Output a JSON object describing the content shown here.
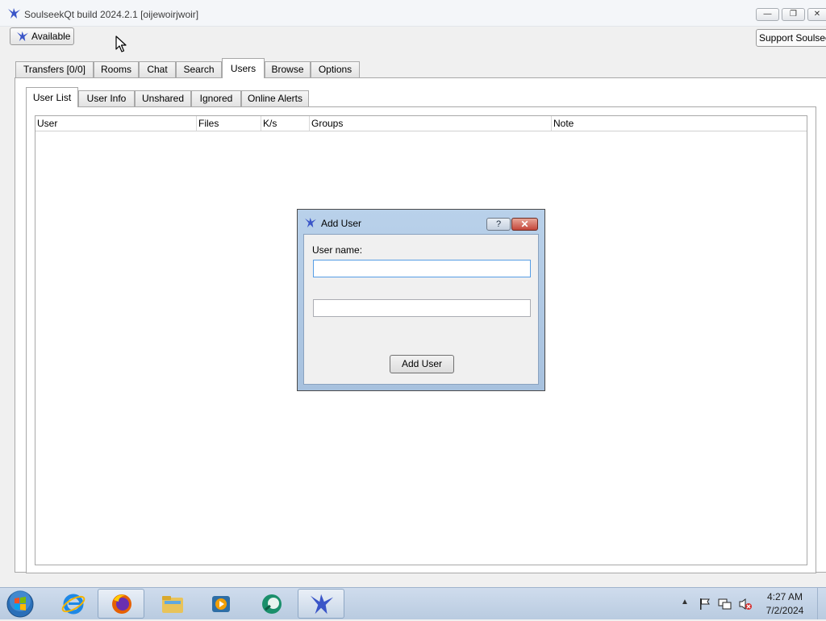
{
  "window": {
    "title": "SoulseekQt build 2024.2.1 [oijewoirjwoir]",
    "controls": {
      "minimize": "—",
      "maximize": "❐",
      "close": "✕"
    }
  },
  "toolbar": {
    "status_label": "Available",
    "support_label": "Support Soulseek"
  },
  "main_tabs": [
    {
      "label": "Transfers [0/0]",
      "active": false
    },
    {
      "label": "Rooms",
      "active": false
    },
    {
      "label": "Chat",
      "active": false
    },
    {
      "label": "Search",
      "active": false
    },
    {
      "label": "Users",
      "active": true
    },
    {
      "label": "Browse",
      "active": false
    },
    {
      "label": "Options",
      "active": false
    }
  ],
  "sub_tabs": [
    {
      "label": "User List",
      "active": true
    },
    {
      "label": "User Info",
      "active": false
    },
    {
      "label": "Unshared",
      "active": false
    },
    {
      "label": "Ignored",
      "active": false
    },
    {
      "label": "Online Alerts",
      "active": false
    }
  ],
  "user_table": {
    "columns": [
      "User",
      "Files",
      "K/s",
      "Groups",
      "Note"
    ],
    "rows": []
  },
  "dialog": {
    "title": "Add User",
    "help_label": "?",
    "close_label": "✕",
    "field_label": "User name:",
    "username_value": "",
    "note_value": "",
    "submit_label": "Add User"
  },
  "taskbar": {
    "pinned": [
      "internet-explorer-icon",
      "firefox-icon",
      "file-explorer-icon",
      "media-player-icon",
      "app-icon"
    ],
    "running": [
      "soulseek-icon"
    ],
    "tray_chevron": "▲",
    "clock_time": "4:27 AM",
    "clock_date": "7/2/2024"
  },
  "colors": {
    "accent": "#569de5",
    "dialog_frame": "#b9d1ea",
    "taskbar": "#c7d6e8",
    "app_icon": "#3a55c8"
  }
}
